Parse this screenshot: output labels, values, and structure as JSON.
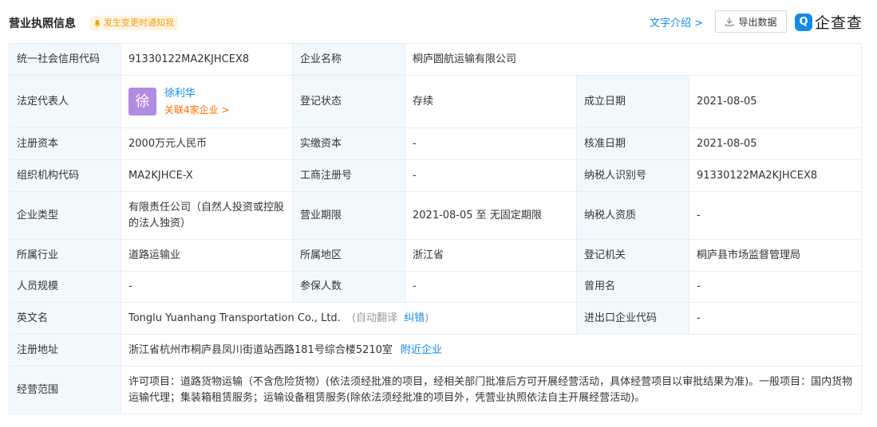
{
  "header": {
    "title": "营业执照信息",
    "notify_label": "发生变更时通知我",
    "text_intro_label": "文字介绍 >",
    "export_label": "导出数据",
    "logo_mark": "Q",
    "logo_text": "企查查"
  },
  "table": {
    "credit_code_label": "统一社会信用代码",
    "credit_code": "91330122MA2KJHCEX8",
    "company_name_label": "企业名称",
    "company_name": "桐庐圆航运输有限公司",
    "legal_rep_label": "法定代表人",
    "legal_rep_avatar": "徐",
    "legal_rep_name": "徐利华",
    "legal_rep_related": "关联4家企业 >",
    "reg_status_label": "登记状态",
    "reg_status": "存续",
    "established_label": "成立日期",
    "established": "2021-08-05",
    "reg_capital_label": "注册资本",
    "reg_capital": "2000万元人民币",
    "paid_capital_label": "实缴资本",
    "paid_capital": "-",
    "approved_label": "核准日期",
    "approved": "2021-08-05",
    "org_code_label": "组织机构代码",
    "org_code": "MA2KJHCE-X",
    "biz_reg_no_label": "工商注册号",
    "biz_reg_no": "-",
    "taxpayer_id_label": "纳税人识别号",
    "taxpayer_id": "91330122MA2KJHCEX8",
    "company_type_label": "企业类型",
    "company_type": "有限责任公司（自然人投资或控股的法人独资）",
    "biz_term_label": "营业期限",
    "biz_term": "2021-08-05 至 无固定期限",
    "taxpayer_qual_label": "纳税人资质",
    "taxpayer_qual": "-",
    "industry_label": "所属行业",
    "industry": "道路运输业",
    "region_label": "所属地区",
    "region": "浙江省",
    "reg_authority_label": "登记机关",
    "reg_authority": "桐庐县市场监督管理局",
    "staff_size_label": "人员规模",
    "staff_size": "-",
    "insured_label": "参保人数",
    "insured": "-",
    "former_name_label": "曾用名",
    "former_name": "-",
    "english_name_label": "英文名",
    "english_name": "Tonglu Yuanhang Transportation Co., Ltd.",
    "auto_translate": "(自动翻译",
    "correct_label": "纠错",
    "close_paren": ")",
    "import_export_label": "进出口企业代码",
    "import_export": "-",
    "address_label": "注册地址",
    "address": "浙江省杭州市桐庐县凤川街道站西路181号综合楼5210室",
    "nearby_label": "附近企业",
    "scope_label": "经营范围",
    "scope": "许可项目：道路货物运输（不含危险货物）(依法须经批准的项目，经相关部门批准后方可开展经营活动，具体经营项目以审批结果为准)。一般项目：国内货物运输代理；集装箱租赁服务；运输设备租赁服务(除依法须经批准的项目外，凭营业执照依法自主开展经营活动)。"
  },
  "colors": {
    "accent_blue": "#128bed",
    "label_bg": "#f2f9fc",
    "border": "#e4eef6",
    "related_orange": "#ff6b00",
    "avatar_purple": "#b18ce0"
  }
}
